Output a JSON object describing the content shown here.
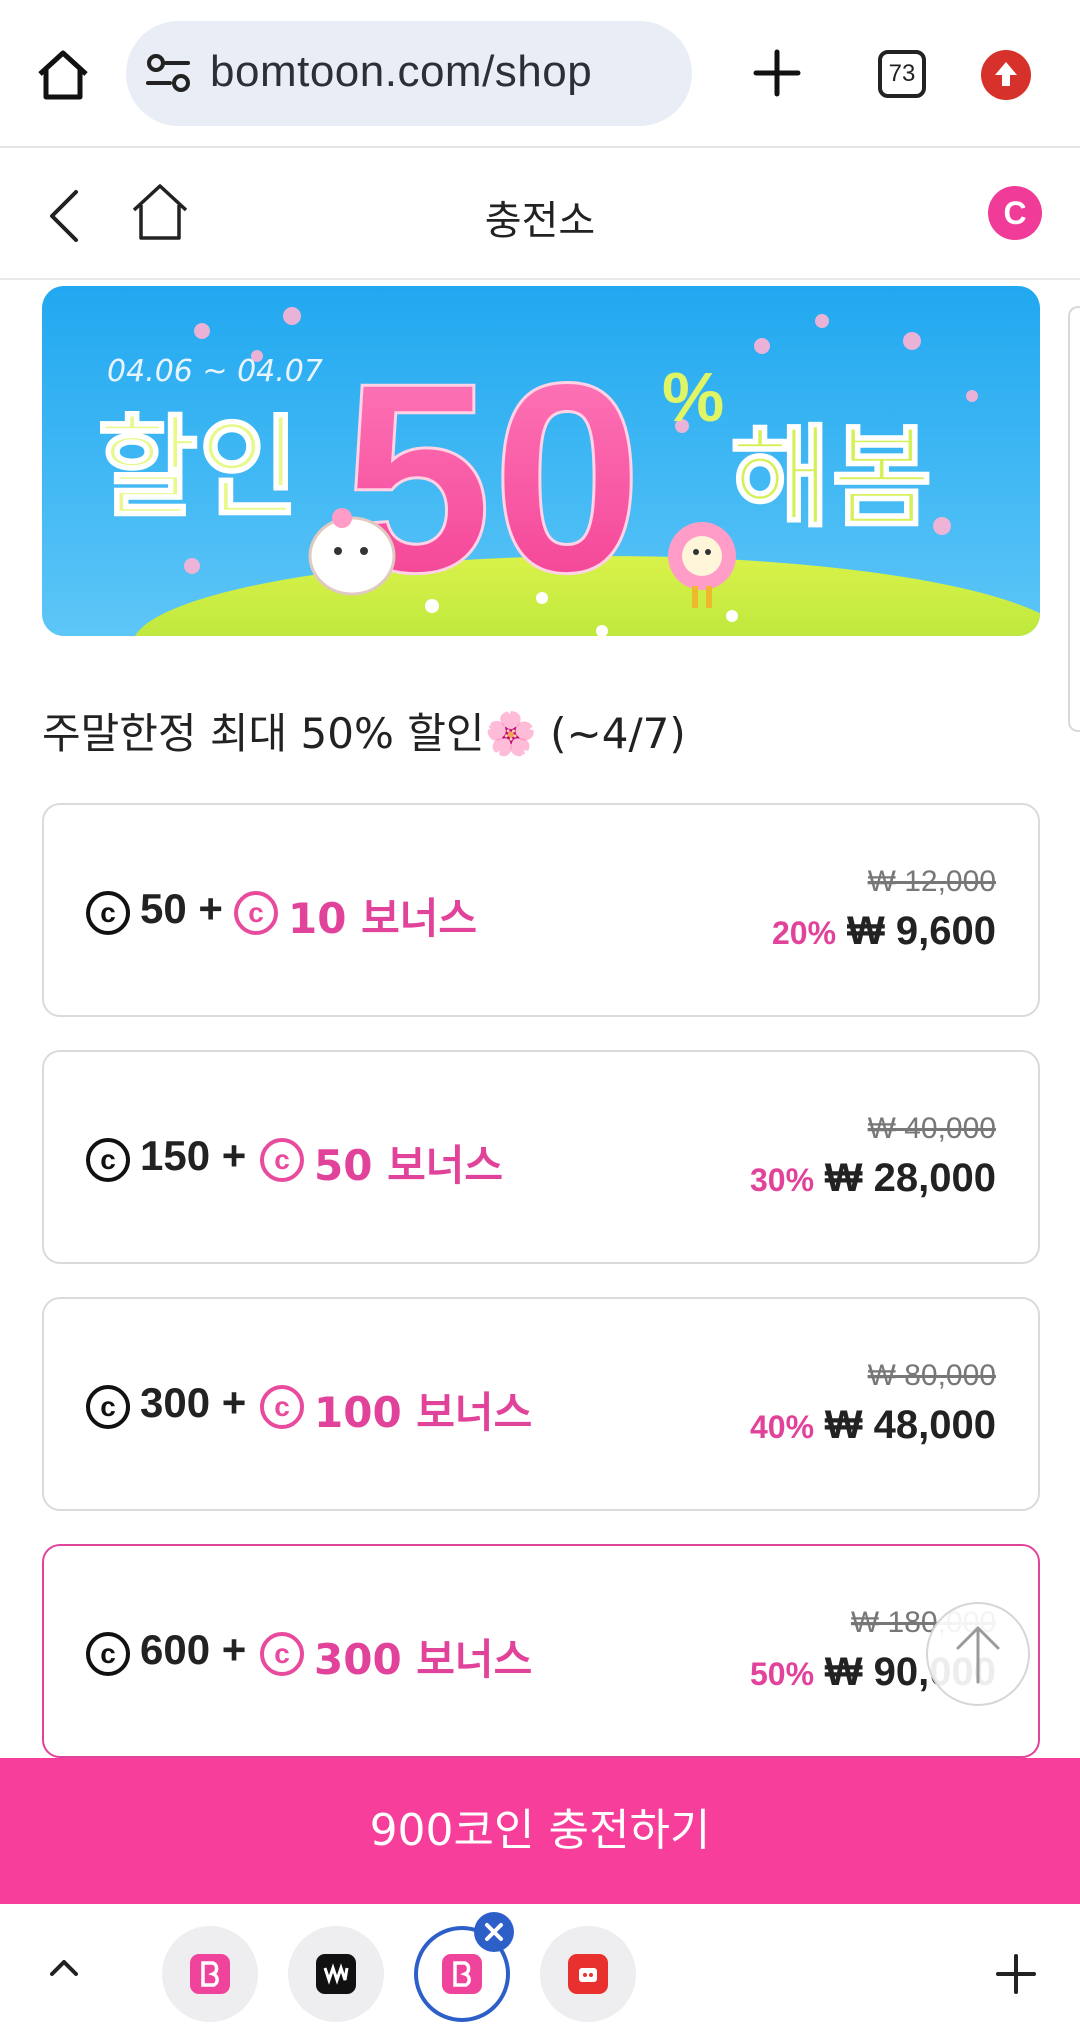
{
  "browser": {
    "url": "bomtoon.com/shop",
    "tab_count": "73"
  },
  "header": {
    "title": "충전소",
    "coin_badge": "C"
  },
  "banner": {
    "dates": "04.06 ~ 04.07",
    "left_word": "할인",
    "big_number": "50",
    "percent": "%",
    "right_word": "해봄"
  },
  "section_title": "주말한정 최대 50% 할인🌸 (~4/7)",
  "coin_symbol": "c",
  "packages": [
    {
      "base": "50 +",
      "bonus": "10 보너스",
      "original_price": "₩ 12,000",
      "discount": "20%",
      "price": "₩ 9,600",
      "selected": false
    },
    {
      "base": "150 +",
      "bonus": "50 보너스",
      "original_price": "₩ 40,000",
      "discount": "30%",
      "price": "₩ 28,000",
      "selected": false
    },
    {
      "base": "300 +",
      "bonus": "100 보너스",
      "original_price": "₩ 80,000",
      "discount": "40%",
      "price": "₩ 48,000",
      "selected": false
    },
    {
      "base": "600 +",
      "bonus": "300 보너스",
      "original_price": "₩ 180,000",
      "discount": "50%",
      "price": "₩ 90,000",
      "selected": true
    }
  ],
  "charge_button": "900코인 충전하기",
  "colors": {
    "accent": "#f63e9a",
    "accent_text": "#e2439a",
    "tab_active": "#2d5fc9"
  }
}
